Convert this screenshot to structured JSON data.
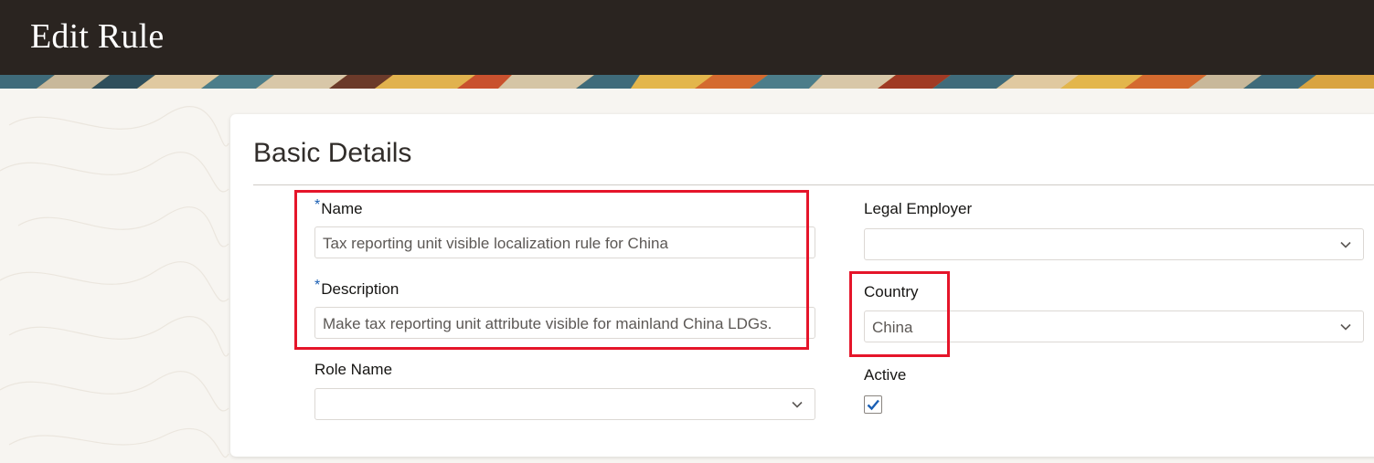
{
  "header": {
    "title": "Edit Rule"
  },
  "section": {
    "title": "Basic Details"
  },
  "form": {
    "name": {
      "label": "Name",
      "required_marker": "*",
      "value": "Tax reporting unit visible localization rule for China"
    },
    "description": {
      "label": "Description",
      "required_marker": "*",
      "value": "Make tax reporting unit attribute visible for mainland China LDGs."
    },
    "role_name": {
      "label": "Role Name",
      "value": ""
    },
    "legal_employer": {
      "label": "Legal Employer",
      "value": ""
    },
    "country": {
      "label": "Country",
      "value": "China"
    },
    "active": {
      "label": "Active",
      "checked": true
    }
  },
  "colors": {
    "header_bg": "#2a2420",
    "highlight_box": "#e5152a",
    "checkbox_accent": "#1a5fb4",
    "required_marker": "#1a5fb4"
  }
}
